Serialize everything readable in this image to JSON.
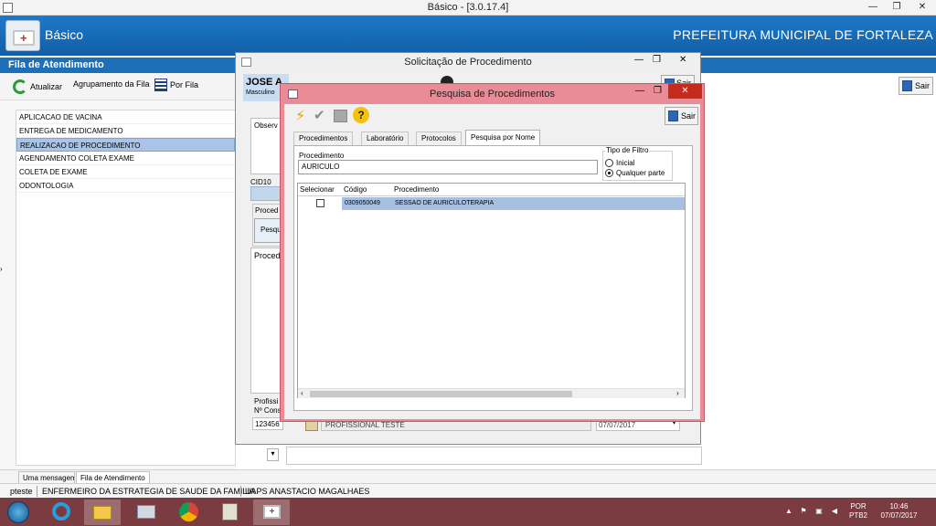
{
  "window": {
    "title": "Básico - [3.0.17.4]",
    "minimize": "—",
    "restore": "❐",
    "close": "✕"
  },
  "header": {
    "app_name": "Básico",
    "org": "PREFEITURA MUNICIPAL DE FORTALEZA"
  },
  "fila": {
    "title": "Fila de Atendimento",
    "toolbar": {
      "atualizar": "Atualizar",
      "agrupamento": "Agrupamento da Fila",
      "por_fila": "Por Fila"
    },
    "items": [
      "APLICACAO DE VACINA",
      "ENTREGA DE MEDICAMENTO",
      "REALIZACAO DE PROCEDIMENTO",
      "AGENDAMENTO COLETA EXAME",
      "COLETA DE EXAME",
      "ODONTOLOGIA"
    ]
  },
  "right": {
    "sair": "Sair"
  },
  "solicitacao": {
    "title": "Solicitação de Procedimento",
    "sair": "Sair",
    "patient_name": "JOSE A",
    "patient_sex": "Masculino",
    "obs_label": "Observ",
    "cid_label": "CID10",
    "proc_group_label": "Proced",
    "pesq_button": "Pesqu",
    "proced_label": "Proced",
    "prof_label": "Profissi",
    "cons_label": "Nº Cons",
    "prof_code": "123456",
    "prof_name": "PROFISSIONAL TESTE",
    "date": "07/07/2017"
  },
  "pesquisa": {
    "title": "Pesquisa de Procedimentos",
    "sair": "Sair",
    "tabs": [
      "Procedimentos",
      "Laboratório",
      "Protocolos",
      "Pesquisa por Nome"
    ],
    "proc_label": "Procedimento",
    "proc_value": "AURICULO",
    "filter_title": "Tipo de Filtro",
    "filter_options": [
      "Inicial",
      "Qualquer parte"
    ],
    "filter_selected": "Qualquer parte",
    "grid_headers": [
      "Selecionar",
      "Código",
      "Procedimento"
    ],
    "rows": [
      {
        "codigo": "0309050049",
        "procedimento": "SESSAO DE AURICULOTERAPIA",
        "selected": false
      }
    ]
  },
  "bottom_tabs": [
    "Uma mensagem",
    "Fila de Atendimento"
  ],
  "status": {
    "user": "pteste",
    "role": "ENFERMEIRO DA ESTRATEGIA DE SAUDE DA FAMILIA",
    "unit": "UAPS ANASTACIO MAGALHAES"
  },
  "tray": {
    "lang": "POR",
    "layout": "PTB2",
    "time": "10:46",
    "date": "07/07/2017"
  },
  "colors": {
    "accent": "#1d6fb8",
    "dialog_frame": "#e98c97",
    "taskbar": "#7a3b41",
    "selection": "#a7c0e0"
  }
}
